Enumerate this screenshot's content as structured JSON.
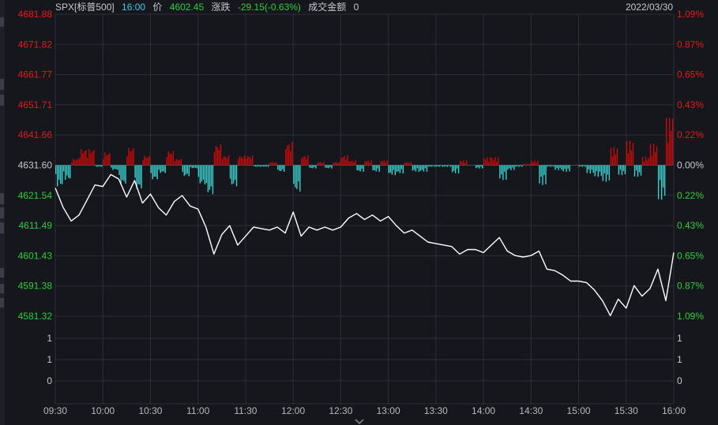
{
  "header": {
    "symbol": "SPX[标普500]",
    "time": "16:00",
    "price_label": "价",
    "price": "4602.45",
    "change_label": "涨跌",
    "change": "-29.15(-0.63%)",
    "turnover_label": "成交金额",
    "turnover": "0",
    "date": "2022/03/30"
  },
  "colors": {
    "background": "#15171c",
    "up": "#e8191b",
    "down": "#19b8b6",
    "up_bar": "#c80a0a",
    "down_bar": "#3ccfcf",
    "price_line": "#ffffff",
    "grid": "#2c2f37",
    "base_line": "#4a4d55",
    "time_text": "#b8b8b8",
    "neutral": "#c8c8c8"
  },
  "chart_data": {
    "type": "line",
    "x_ticks": [
      "09:30",
      "10:00",
      "10:30",
      "11:00",
      "11:30",
      "12:00",
      "12:30",
      "13:00",
      "13:30",
      "14:00",
      "14:30",
      "15:00",
      "15:30",
      "16:00"
    ],
    "y_ticks_left": [
      "4681.88",
      "4671.82",
      "4661.77",
      "4651.71",
      "4641.66",
      "4631.60",
      "4621.54",
      "4611.49",
      "4601.43",
      "4591.38",
      "4581.32"
    ],
    "y_ticks_right": [
      "1.09%",
      "0.87%",
      "0.65%",
      "0.43%",
      "0.22%",
      "0.00%",
      "0.22%",
      "0.43%",
      "0.65%",
      "0.87%",
      "1.09%"
    ],
    "ylim": [
      4581.32,
      4681.88
    ],
    "base_price": 4631.6,
    "volume_ticks": [
      "1",
      "1",
      "0"
    ],
    "price_series": [
      {
        "t": "09:30",
        "v": 4624.0
      },
      {
        "t": "09:35",
        "v": 4617.5
      },
      {
        "t": "09:40",
        "v": 4613.0
      },
      {
        "t": "09:45",
        "v": 4615.0
      },
      {
        "t": "09:50",
        "v": 4620.0
      },
      {
        "t": "09:55",
        "v": 4625.0
      },
      {
        "t": "10:00",
        "v": 4624.5
      },
      {
        "t": "10:05",
        "v": 4628.5
      },
      {
        "t": "10:10",
        "v": 4627.0
      },
      {
        "t": "10:15",
        "v": 4621.0
      },
      {
        "t": "10:20",
        "v": 4626.5
      },
      {
        "t": "10:25",
        "v": 4619.0
      },
      {
        "t": "10:30",
        "v": 4622.0
      },
      {
        "t": "10:35",
        "v": 4617.5
      },
      {
        "t": "10:40",
        "v": 4615.0
      },
      {
        "t": "10:45",
        "v": 4619.5
      },
      {
        "t": "10:50",
        "v": 4621.5
      },
      {
        "t": "10:55",
        "v": 4618.0
      },
      {
        "t": "11:00",
        "v": 4617.0
      },
      {
        "t": "11:05",
        "v": 4611.0
      },
      {
        "t": "11:10",
        "v": 4602.0
      },
      {
        "t": "11:15",
        "v": 4608.5
      },
      {
        "t": "11:20",
        "v": 4611.5
      },
      {
        "t": "11:25",
        "v": 4605.0
      },
      {
        "t": "11:30",
        "v": 4608.0
      },
      {
        "t": "11:35",
        "v": 4611.0
      },
      {
        "t": "11:40",
        "v": 4610.5
      },
      {
        "t": "11:45",
        "v": 4610.0
      },
      {
        "t": "11:50",
        "v": 4611.0
      },
      {
        "t": "11:55",
        "v": 4609.0
      },
      {
        "t": "12:00",
        "v": 4616.0
      },
      {
        "t": "12:05",
        "v": 4608.0
      },
      {
        "t": "12:10",
        "v": 4611.0
      },
      {
        "t": "12:15",
        "v": 4610.0
      },
      {
        "t": "12:20",
        "v": 4611.0
      },
      {
        "t": "12:25",
        "v": 4610.0
      },
      {
        "t": "12:30",
        "v": 4611.0
      },
      {
        "t": "12:35",
        "v": 4614.0
      },
      {
        "t": "12:40",
        "v": 4615.5
      },
      {
        "t": "12:45",
        "v": 4613.5
      },
      {
        "t": "12:50",
        "v": 4615.0
      },
      {
        "t": "12:55",
        "v": 4613.0
      },
      {
        "t": "13:00",
        "v": 4614.5
      },
      {
        "t": "13:05",
        "v": 4611.5
      },
      {
        "t": "13:10",
        "v": 4609.0
      },
      {
        "t": "13:15",
        "v": 4610.0
      },
      {
        "t": "13:20",
        "v": 4608.0
      },
      {
        "t": "13:25",
        "v": 4606.0
      },
      {
        "t": "13:30",
        "v": 4605.5
      },
      {
        "t": "13:35",
        "v": 4605.0
      },
      {
        "t": "13:40",
        "v": 4604.5
      },
      {
        "t": "13:45",
        "v": 4602.0
      },
      {
        "t": "13:50",
        "v": 4603.5
      },
      {
        "t": "13:55",
        "v": 4603.5
      },
      {
        "t": "14:00",
        "v": 4602.5
      },
      {
        "t": "14:05",
        "v": 4605.0
      },
      {
        "t": "14:10",
        "v": 4607.5
      },
      {
        "t": "14:15",
        "v": 4603.0
      },
      {
        "t": "14:20",
        "v": 4601.5
      },
      {
        "t": "14:25",
        "v": 4601.0
      },
      {
        "t": "14:30",
        "v": 4601.5
      },
      {
        "t": "14:35",
        "v": 4603.0
      },
      {
        "t": "14:40",
        "v": 4597.0
      },
      {
        "t": "14:45",
        "v": 4596.5
      },
      {
        "t": "14:50",
        "v": 4595.0
      },
      {
        "t": "14:55",
        "v": 4593.0
      },
      {
        "t": "15:00",
        "v": 4593.0
      },
      {
        "t": "15:05",
        "v": 4592.5
      },
      {
        "t": "15:10",
        "v": 4590.0
      },
      {
        "t": "15:15",
        "v": 4586.5
      },
      {
        "t": "15:20",
        "v": 4581.5
      },
      {
        "t": "15:25",
        "v": 4587.0
      },
      {
        "t": "15:30",
        "v": 4584.0
      },
      {
        "t": "15:35",
        "v": 4591.5
      },
      {
        "t": "15:40",
        "v": 4588.0
      },
      {
        "t": "15:45",
        "v": 4590.5
      },
      {
        "t": "15:50",
        "v": 4597.0
      },
      {
        "t": "15:55",
        "v": 4586.5
      },
      {
        "t": "16:00",
        "v": 4602.5
      }
    ],
    "volume_note": "",
    "grid": true
  }
}
